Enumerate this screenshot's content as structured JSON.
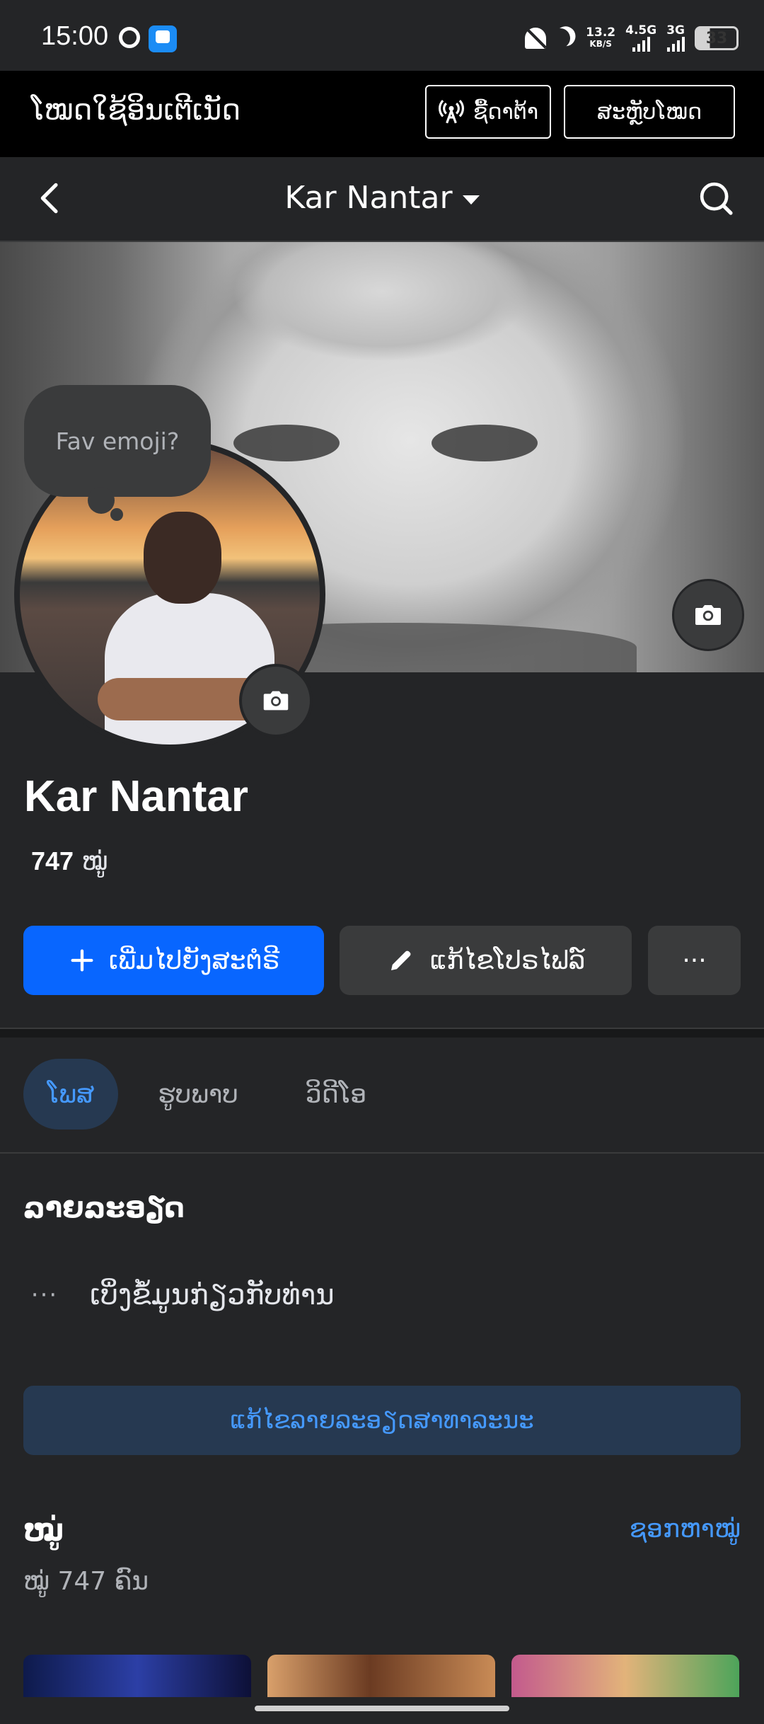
{
  "status_bar": {
    "time": "15:00",
    "net_speed_value": "13.2",
    "net_speed_unit": "KB/S",
    "network_1": "4.5G",
    "network_2": "3G",
    "battery": "33"
  },
  "free_mode_banner": {
    "title": "ໂໝດໃຊ້ອິນເຕີເນັດ",
    "data_button": "ຊື້ດາຕ້າ",
    "switch_button": "ສະຫຼັບໂໝດ"
  },
  "nav": {
    "title": "Kar Nantar"
  },
  "bubble": {
    "text": "Fav emoji?"
  },
  "profile": {
    "name": "Kar Nantar",
    "friends_number": "747",
    "friends_word": "ໝູ່"
  },
  "actions": {
    "add_story": "ເພີ່ມໄປຍັງສະຕໍຣີ",
    "edit_profile": "ແກ້ໄຂໂປຣໄຟລ໌",
    "more": "···"
  },
  "tabs": {
    "posts": "ໂພສ",
    "photos": "ຮູບພາບ",
    "videos": "ວິດີໂອ"
  },
  "details": {
    "title": "ລາຍລະອຽດ",
    "see_about": "ເບິ່ງຂໍ້ມູນກ່ຽວກັບທ່ານ",
    "dots": "···",
    "edit_public": "ແກ້ໄຂລາຍລະອຽດສາທາລະນະ"
  },
  "friends_section": {
    "title": "ໝູ່",
    "find": "ຊອກຫາໝູ່",
    "count_text": "ໝູ່ 747 ຄົນ"
  },
  "icons": {
    "back": "chevron-left-icon",
    "search": "search-icon",
    "camera": "camera-icon",
    "plus": "plus-icon",
    "pencil": "pencil-icon",
    "antenna": "broadcast-icon"
  },
  "colors": {
    "accent": "#0866ff",
    "link": "#4599ff",
    "background": "#242527"
  }
}
